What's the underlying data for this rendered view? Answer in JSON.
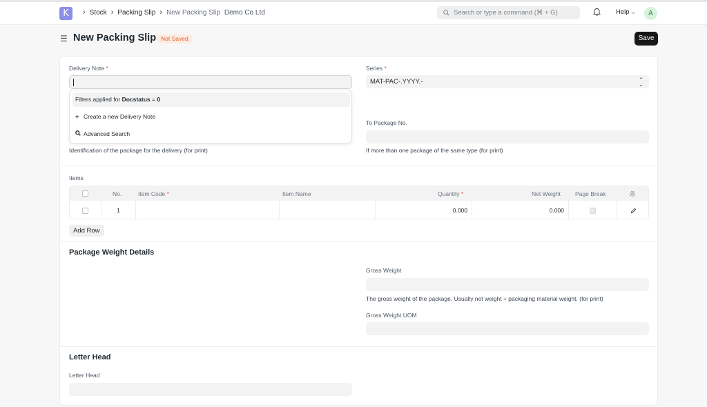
{
  "navbar": {
    "logo_letter": "K",
    "breadcrumbs": [
      "Stock",
      "Packing Slip",
      "New Packing Slip"
    ],
    "company": "Demo Co Ltd",
    "search_placeholder": "Search or type a command (⌘ + G)",
    "help_label": "Help",
    "avatar_letter": "A"
  },
  "header": {
    "title": "New Packing Slip",
    "status": "Not Saved",
    "save_label": "Save"
  },
  "form": {
    "delivery_note": {
      "label": "Delivery Note",
      "value": ""
    },
    "series": {
      "label": "Series",
      "value": "MAT-PAC-.YYYY.-"
    },
    "dropdown": {
      "filter_prefix": "Filters applied for ",
      "filter_field": "Docstatus",
      "filter_op": " = ",
      "filter_value": "0",
      "create_label": "Create a new Delivery Note",
      "advanced_label": "Advanced Search"
    },
    "to_package": {
      "label": "To Package No.",
      "value": "",
      "description": "If more than one package of the same type (for print)"
    },
    "from_package_description": "Identification of the package for the delivery (for print)",
    "items": {
      "label": "Items",
      "columns": [
        "No.",
        "Item Code",
        "Item Name",
        "Quantity",
        "Net Weight",
        "Page Break"
      ],
      "rows": [
        {
          "no": "1",
          "item_code": "",
          "item_name": "",
          "quantity": "0.000",
          "net_weight": "0.000",
          "page_break": false
        }
      ],
      "add_row_label": "Add Row"
    },
    "package_weight": {
      "title": "Package Weight Details",
      "gross_weight_label": "Gross Weight",
      "gross_weight_value": "",
      "gross_weight_description": "The gross weight of the package. Usually net weight + packaging material weight. (for print)",
      "gross_weight_uom_label": "Gross Weight UOM",
      "gross_weight_uom_value": ""
    },
    "letter_head": {
      "title": "Letter Head",
      "label": "Letter Head",
      "value": ""
    }
  },
  "colors": {
    "logo_bg": "#8b8fe8",
    "status_bg": "#fdece2",
    "status_text": "#e0662b",
    "save_bg": "#171717",
    "required": "#e24c4c"
  }
}
